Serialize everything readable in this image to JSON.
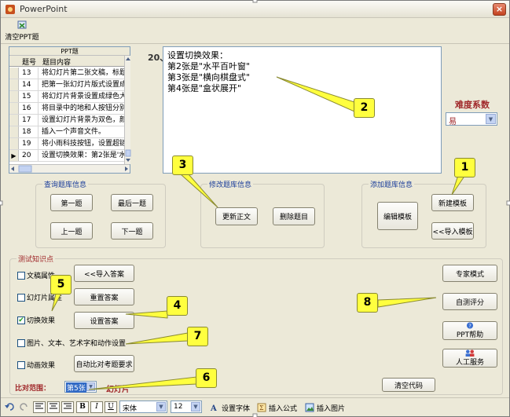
{
  "window": {
    "title": "PowerPoint",
    "close_glyph": "×"
  },
  "toolbar": {
    "clear_label": "清空PPT题"
  },
  "grid": {
    "header": "PPT题",
    "col_num": "题号",
    "col_content": "题目内容",
    "rows": [
      {
        "num": "13",
        "text": "将幻灯片第二张文稿，标题"
      },
      {
        "num": "14",
        "text": "把第一张幻灯片版式设置成"
      },
      {
        "num": "15",
        "text": "将幻灯片背景设置成绿色大"
      },
      {
        "num": "16",
        "text": "将目录中的地和人按钮分别"
      },
      {
        "num": "17",
        "text": "设置幻灯片背景为双色，颜"
      },
      {
        "num": "18",
        "text": "插入一个声音文件。"
      },
      {
        "num": "19",
        "text": "将小雨科技按钮，设置超链"
      },
      {
        "num": "20",
        "text": "设置切换效果：第2张是'水"
      }
    ],
    "current_marker": "▶"
  },
  "question": {
    "number": "20、",
    "text": "设置切换效果：\n第2张是\"水平百叶窗\"\n第3张是\"横向棋盘式\"\n第4张是\"盒状展开\""
  },
  "difficulty": {
    "label": "难度系数",
    "value": "易"
  },
  "query_group": {
    "label": "查询题库信息",
    "first": "第一题",
    "last": "最后一题",
    "prev": "上一题",
    "next": "下一题"
  },
  "modify_group": {
    "label": "修改题库信息",
    "update": "更新正文",
    "delete": "删除题目"
  },
  "add_group": {
    "label": "添加题库信息",
    "edit": "编辑模板",
    "new": "新建模板",
    "import": "<<导入模板"
  },
  "knowledge": {
    "label": "测试知识点",
    "checks": [
      {
        "label": "文稿属性",
        "checked": false
      },
      {
        "label": "幻灯片属性",
        "checked": false
      },
      {
        "label": "切换效果",
        "checked": true
      },
      {
        "label": "图片、文本、艺术字和动作设置",
        "checked": false
      },
      {
        "label": "动画效果",
        "checked": false
      }
    ],
    "import_answer": "<<导入答案",
    "reset_answer": "重置答案",
    "set_answer": "设置答案",
    "auto_compare": "自动比对考题要求",
    "expert": "专家模式",
    "self_score": "自测评分",
    "ppt_help": "PPT帮助",
    "manual_service": "人工服务",
    "clear_code": "清空代码"
  },
  "compare": {
    "label": "比对范围：",
    "value": "第5张",
    "slide_label": "幻灯片"
  },
  "format_bar": {
    "bold": "B",
    "italic": "I",
    "underline": "U",
    "font": "宋体",
    "size": "12",
    "set_font": "设置字体",
    "insert_formula": "插入公式",
    "insert_image": "插入图片"
  },
  "callouts": [
    "1",
    "2",
    "3",
    "4",
    "5",
    "6",
    "7",
    "8"
  ],
  "colors": {
    "accent_red": "#a0282a",
    "callout_yellow": "#ffff3f",
    "group_label_blue": "#1a3d9a"
  }
}
